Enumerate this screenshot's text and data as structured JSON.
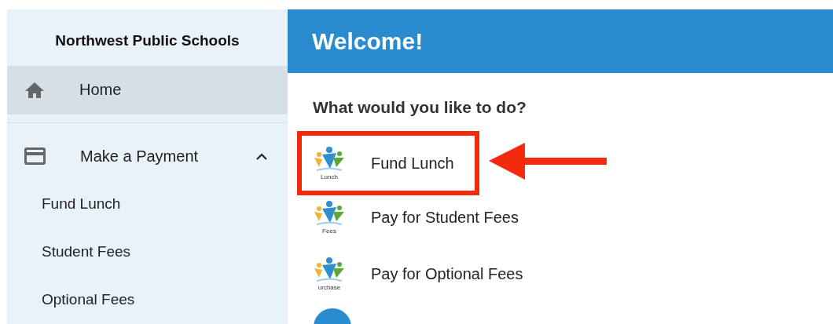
{
  "sidebar": {
    "title": "Northwest Public Schools",
    "items": [
      {
        "label": "Home",
        "kind": "home",
        "selected": true,
        "expanded": false
      },
      {
        "label": "Make a Payment",
        "kind": "card",
        "selected": false,
        "expanded": true,
        "children": [
          {
            "label": "Fund Lunch"
          },
          {
            "label": "Student Fees"
          },
          {
            "label": "Optional Fees"
          }
        ]
      }
    ]
  },
  "header": {
    "title": "Welcome!"
  },
  "main": {
    "heading": "What would you like to do?",
    "actions": [
      {
        "label": "Fund Lunch",
        "caption": "Lunch",
        "highlighted": true,
        "kind": "logo"
      },
      {
        "label": "Pay for Student Fees",
        "caption": "Fees",
        "highlighted": false,
        "kind": "logo"
      },
      {
        "label": "Pay for Optional Fees",
        "caption": "urchase",
        "highlighted": false,
        "kind": "logo"
      },
      {
        "kind": "circle"
      }
    ]
  }
}
